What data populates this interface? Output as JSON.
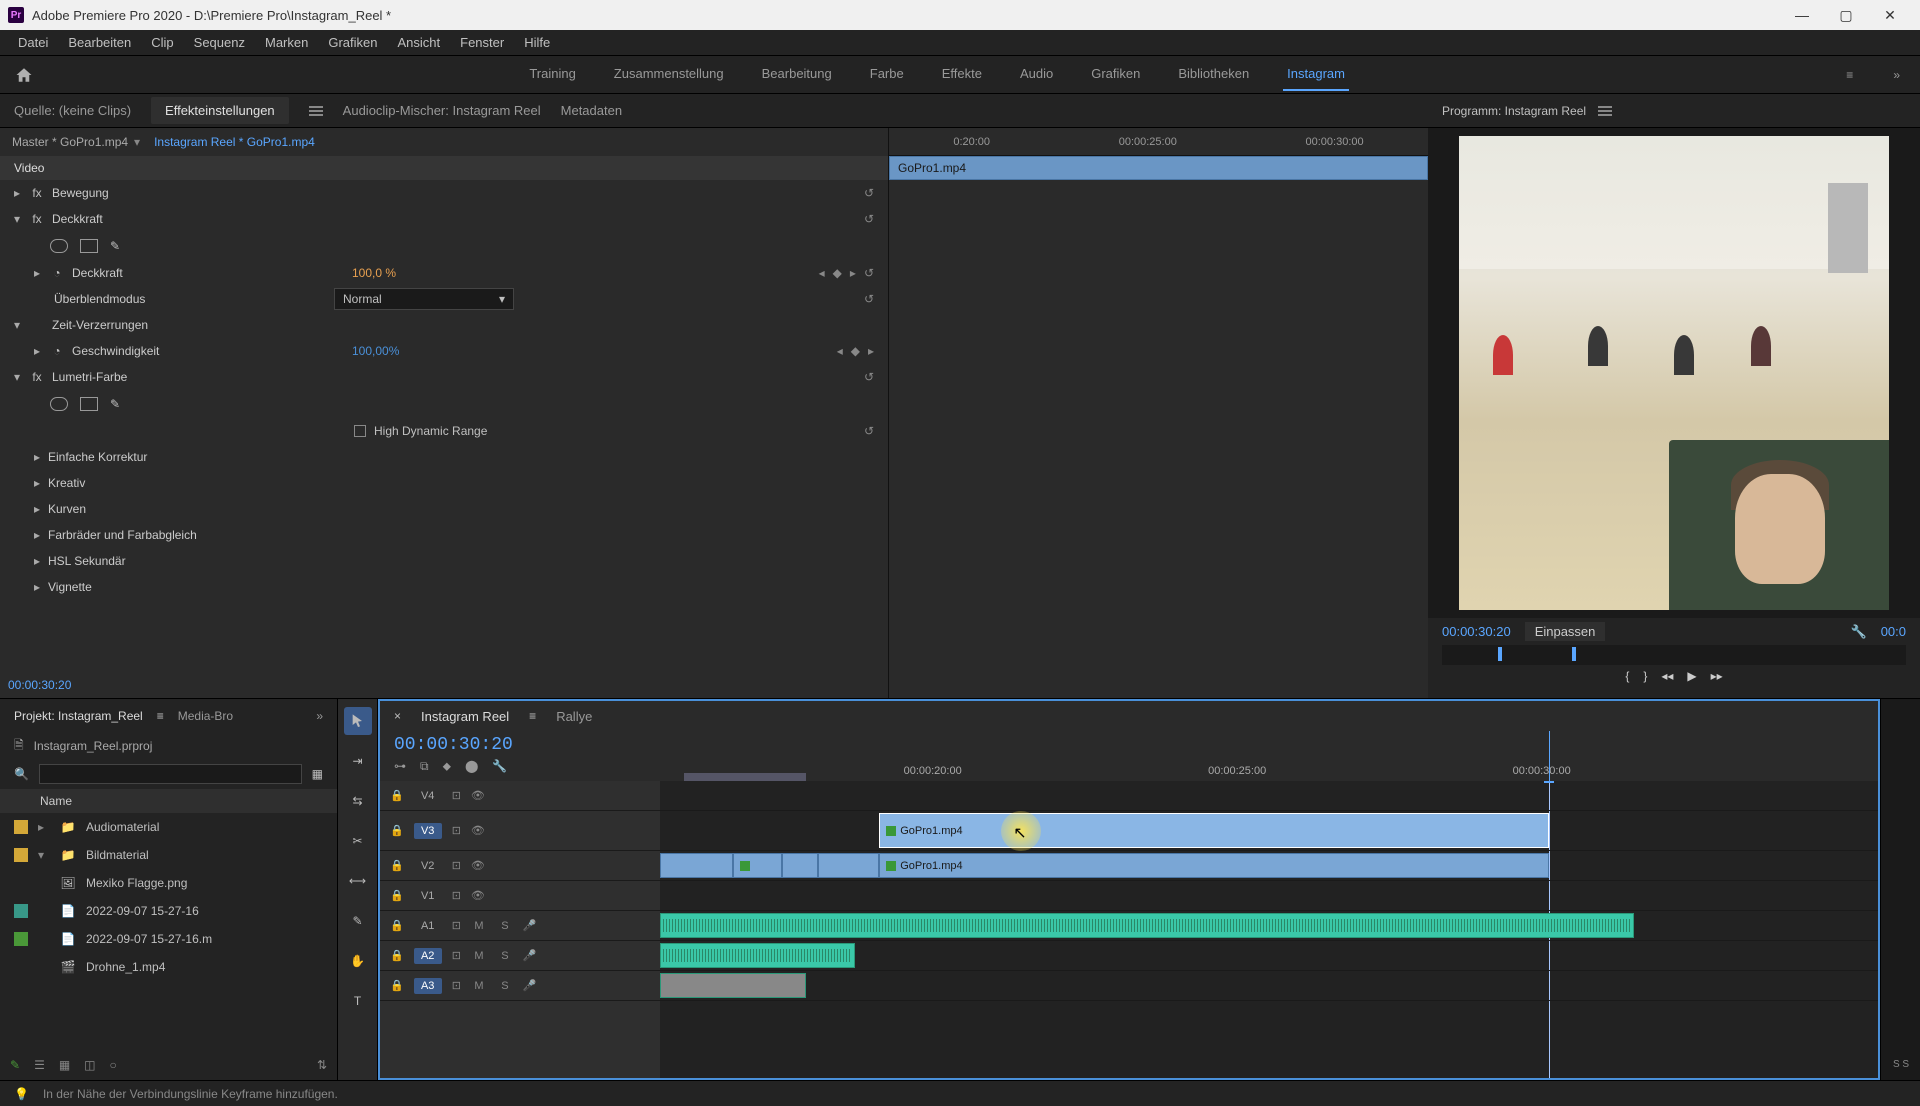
{
  "titlebar": {
    "app_icon_text": "Pr",
    "title": "Adobe Premiere Pro 2020 - D:\\Premiere Pro\\Instagram_Reel *"
  },
  "menu": [
    "Datei",
    "Bearbeiten",
    "Clip",
    "Sequenz",
    "Marken",
    "Grafiken",
    "Ansicht",
    "Fenster",
    "Hilfe"
  ],
  "workspaces": [
    "Training",
    "Zusammenstellung",
    "Bearbeitung",
    "Farbe",
    "Effekte",
    "Audio",
    "Grafiken",
    "Bibliotheken",
    "Instagram"
  ],
  "workspace_active": "Instagram",
  "source_panel": {
    "tabs": [
      "Quelle: (keine Clips)",
      "Effekteinstellungen",
      "Audioclip-Mischer: Instagram Reel",
      "Metadaten"
    ],
    "active_tab": "Effekteinstellungen",
    "master": "Master * GoPro1.mp4",
    "sequence": "Instagram Reel * GoPro1.mp4",
    "section_video": "Video",
    "fx_bewegung": "Bewegung",
    "fx_deckkraft": "Deckkraft",
    "prop_deckkraft": "Deckkraft",
    "val_deckkraft": "100,0 %",
    "prop_blend": "Überblendmodus",
    "val_blend": "Normal",
    "fx_zeit": "Zeit-Verzerrungen",
    "prop_speed": "Geschwindigkeit",
    "val_speed": "100,00%",
    "fx_lumetri": "Lumetri-Farbe",
    "hdr_label": "High Dynamic Range",
    "sub_einfache": "Einfache Korrektur",
    "sub_kreativ": "Kreativ",
    "sub_kurven": "Kurven",
    "sub_farbrad": "Farbräder und Farbabgleich",
    "sub_hsl": "HSL Sekundär",
    "sub_vignette": "Vignette",
    "timecode": "00:00:30:20",
    "ruler_ticks": [
      "0:20:00",
      "00:00:25:00",
      "00:00:30:00"
    ],
    "clip_name": "GoPro1.mp4"
  },
  "program": {
    "title": "Programm: Instagram Reel",
    "timecode": "00:00:30:20",
    "fit": "Einpassen",
    "duration": "00:0"
  },
  "project": {
    "tab1": "Projekt: Instagram_Reel",
    "tab2": "Media-Bro",
    "path": "Instagram_Reel.prproj",
    "col_name": "Name",
    "items": [
      {
        "color": "c-yellow",
        "twisty": "▸",
        "icon": "📁",
        "label": "Audiomaterial",
        "indent": 1
      },
      {
        "color": "c-yellow",
        "twisty": "▾",
        "icon": "📁",
        "label": "Bildmaterial",
        "indent": 1
      },
      {
        "color": "",
        "twisty": "",
        "icon": "🖼",
        "label": "Mexiko Flagge.png",
        "indent": 2
      },
      {
        "color": "c-teal",
        "twisty": "",
        "icon": "📄",
        "label": "2022-09-07 15-27-16",
        "indent": 1
      },
      {
        "color": "c-green",
        "twisty": "",
        "icon": "📄",
        "label": "2022-09-07 15-27-16.m",
        "indent": 1
      },
      {
        "color": "",
        "twisty": "",
        "icon": "🎬",
        "label": "Drohne_1.mp4",
        "indent": 2
      }
    ]
  },
  "timeline": {
    "tabs": [
      "Instagram Reel",
      "Rallye"
    ],
    "active_tab": "Instagram Reel",
    "timecode": "00:00:30:20",
    "ruler": [
      "00:00:20:00",
      "00:00:25:00",
      "00:00:30:00"
    ],
    "tracks_v": [
      "V4",
      "V3",
      "V2",
      "V1"
    ],
    "tracks_a": [
      "A1",
      "A2",
      "A3"
    ],
    "clip_v3": "GoPro1.mp4",
    "clip_v2": "GoPro1.mp4",
    "meter_label": "S S"
  },
  "status": {
    "text": "In der Nähe der Verbindungslinie Keyframe hinzufügen."
  }
}
